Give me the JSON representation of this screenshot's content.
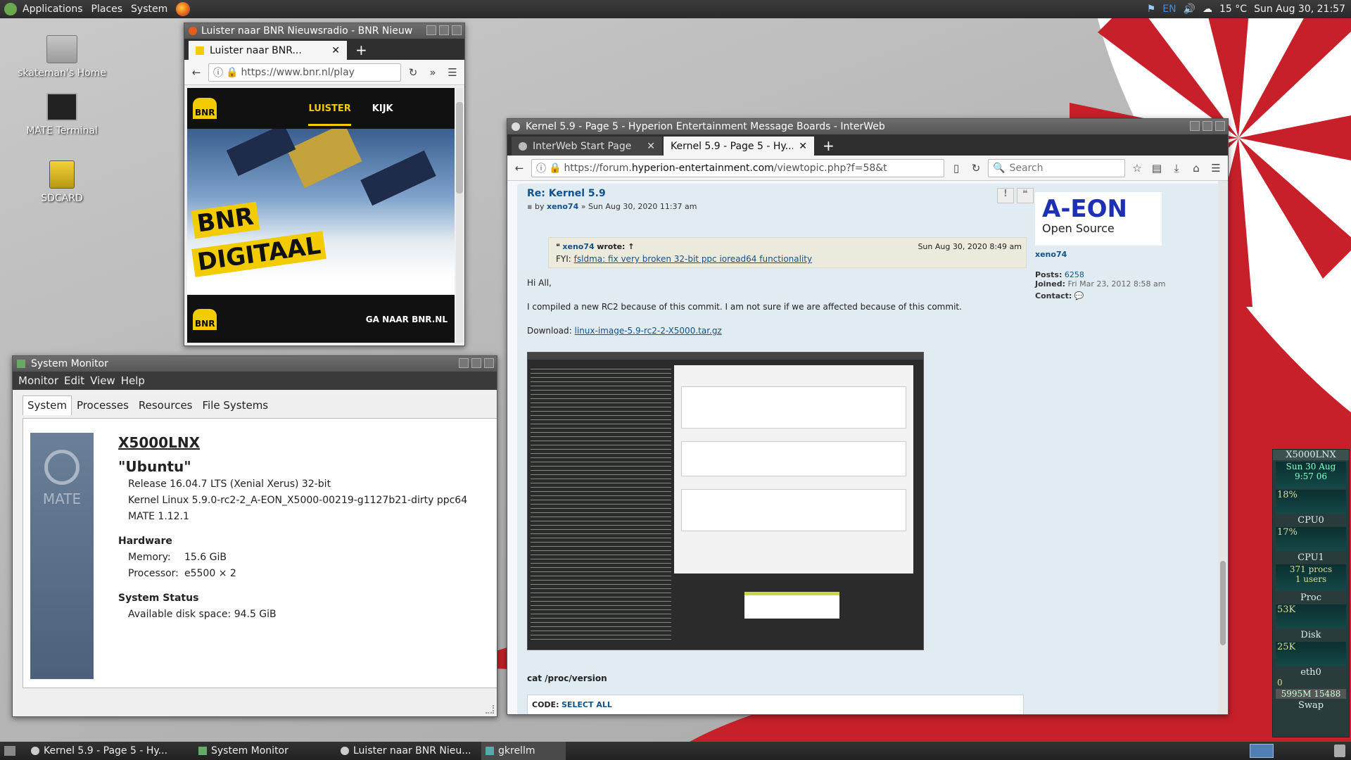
{
  "top_panel": {
    "menus": [
      "Applications",
      "Places",
      "System"
    ],
    "tray_lang": "EN",
    "tray_weather": "15 °C",
    "tray_clock": "Sun Aug 30, 21:57"
  },
  "desktop_icons": [
    {
      "label": "skateman's Home"
    },
    {
      "label": "MATE Terminal"
    },
    {
      "label": "SDCARD"
    }
  ],
  "bnr_window": {
    "title": "Luister naar BNR Nieuwsradio - BNR Nieuw",
    "tab_label": "Luister naar BNR...",
    "url": "https://www.bnr.nl/play",
    "nav_logo": "BNR",
    "nav_items": [
      "LUISTER",
      "KIJK"
    ],
    "promo_line1": "BNR",
    "promo_line2": "DIGITAAL",
    "footer_link": "GA NAAR BNR.NL"
  },
  "interweb_window": {
    "title": "Kernel 5.9 - Page 5 - Hyperion Entertainment Message Boards - InterWeb",
    "tabs": [
      {
        "label": "InterWeb Start Page"
      },
      {
        "label": "Kernel 5.9 - Page 5 - Hy..."
      }
    ],
    "url_prefix": "https://forum.",
    "url_domain": "hyperion-entertainment.com",
    "url_suffix": "/viewtopic.php?f=58&t",
    "search_placeholder": "Search",
    "post": {
      "title": "Re: Kernel 5.9",
      "by": "by",
      "author": "xeno74",
      "date": "» Sun Aug 30, 2020 11:37 am",
      "quote_author": "xeno74",
      "quote_wrote": "wrote: ↑",
      "quote_date": "Sun Aug 30, 2020 8:49 am",
      "quote_fyi": "FYI:",
      "quote_link": "fsldma: fix very broken 32-bit ppc ioread64 functionality",
      "p1": "Hi All,",
      "p2": "I compiled a new RC2 because of this commit. I am not sure if we are affected because of this commit.",
      "download_label": "Download:",
      "download_link": "linux-image-5.9-rc2-2-X5000.tar.gz",
      "cmd": "cat /proc/version",
      "code_label": "CODE:",
      "code_select": "SELECT ALL"
    },
    "profile": {
      "logo_line1": "A-EON",
      "logo_line2": "Open Source",
      "username": "xeno74",
      "posts_label": "Posts:",
      "posts_value": "6258",
      "joined_label": "Joined:",
      "joined_value": "Fri Mar 23, 2012 8:58 am",
      "contact_label": "Contact:"
    }
  },
  "system_monitor": {
    "title": "System Monitor",
    "menus": [
      "Monitor",
      "Edit",
      "View",
      "Help"
    ],
    "tabs": [
      "System",
      "Processes",
      "Resources",
      "File Systems"
    ],
    "hostname": "X5000LNX",
    "distro": "\"Ubuntu\"",
    "release": "Release 16.04.7 LTS (Xenial Xerus) 32-bit",
    "kernel": "Kernel Linux 5.9.0-rc2-2_A-EON_X5000-00219-g1127b21-dirty ppc64",
    "mate": "MATE 1.12.1",
    "hardware_heading": "Hardware",
    "memory_label": "Memory:",
    "memory_value": "15.6 GiB",
    "processor_label": "Processor:",
    "processor_value": "e5500 × 2",
    "status_heading": "System Status",
    "disk_label": "Available disk space:",
    "disk_value": "94.5 GiB",
    "logo_text": "MATE"
  },
  "gkrellm": {
    "host": "X5000LNX",
    "date": "Sun 30 Aug",
    "time": "9:57 06",
    "cpu0_pct": "18%",
    "cpu0_label": "CPU0",
    "cpu1_pct": "17%",
    "cpu1_label": "CPU1",
    "procs": "371 procs",
    "users": "1 users",
    "proc_label": "Proc",
    "disk_val": "53K",
    "disk_label": "Disk",
    "net_val": "25K",
    "net_label": "eth0",
    "net_zero": "0",
    "swap_val": "5995M  15488",
    "swap_label": "Swap"
  },
  "taskbar": [
    {
      "label": "Kernel 5.9 - Page 5 - Hy..."
    },
    {
      "label": "System Monitor"
    },
    {
      "label": "Luister naar BNR Nieu..."
    },
    {
      "label": "gkrellm"
    }
  ]
}
